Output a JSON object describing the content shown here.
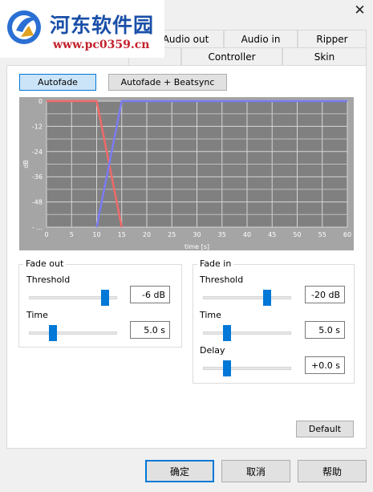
{
  "window": {
    "close_label": "✕"
  },
  "watermark": {
    "title": "河东软件园",
    "url": "www.pc0359.cn"
  },
  "tabs_row1": [
    "Audio out",
    "Audio in",
    "Ripper"
  ],
  "tabs_row2": [
    "Controller",
    "Skin"
  ],
  "modes": {
    "autofade": "Autofade",
    "autofade_beatsync": "Autofade + Beatsync"
  },
  "chart_data": {
    "type": "line",
    "xlabel": "time [s]",
    "ylabel": "dB",
    "x_ticks": [
      0,
      5,
      10,
      15,
      20,
      25,
      30,
      35,
      40,
      45,
      50,
      55,
      60
    ],
    "y_ticks": [
      "0",
      "-12",
      "-24",
      "-36",
      "-48",
      "- ..."
    ],
    "xlim": [
      0,
      60
    ],
    "ylim": [
      -60,
      0
    ],
    "grid": true,
    "series": [
      {
        "color": "#f06a6a",
        "points": [
          [
            0,
            0
          ],
          [
            10,
            0
          ],
          [
            15,
            -60
          ]
        ]
      },
      {
        "color": "#7b7bf2",
        "points": [
          [
            10,
            -60
          ],
          [
            15,
            0
          ],
          [
            60,
            0
          ]
        ]
      }
    ]
  },
  "fade_out": {
    "title": "Fade out",
    "threshold_label": "Threshold",
    "threshold_value": "-6 dB",
    "threshold_level": 0.9,
    "time_label": "Time",
    "time_value": "5.0 s",
    "time_level": 0.25
  },
  "fade_in": {
    "title": "Fade in",
    "threshold_label": "Threshold",
    "threshold_value": "-20 dB",
    "threshold_level": 0.75,
    "time_label": "Time",
    "time_value": "5.0 s",
    "time_level": 0.25,
    "delay_label": "Delay",
    "delay_value": "+0.0 s",
    "delay_level": 0.25
  },
  "buttons": {
    "default": "Default",
    "ok": "确定",
    "cancel": "取消",
    "help": "帮助"
  }
}
